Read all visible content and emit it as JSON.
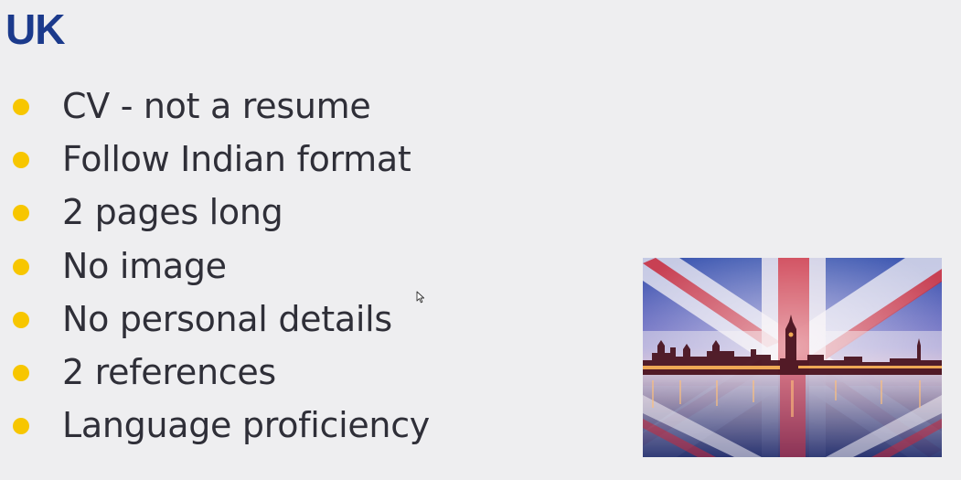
{
  "slide": {
    "title": "UK",
    "bullets": [
      "CV - not a resume",
      "Follow Indian format",
      "2 pages long",
      "No image",
      "No personal details",
      "2 references",
      "Language proficiency"
    ]
  },
  "colors": {
    "background": "#eeeef0",
    "title": "#1b3a8c",
    "bullet_dot": "#f7c600",
    "text": "#2f2f38"
  },
  "image": {
    "subject": "union-jack-westminster-photo"
  }
}
